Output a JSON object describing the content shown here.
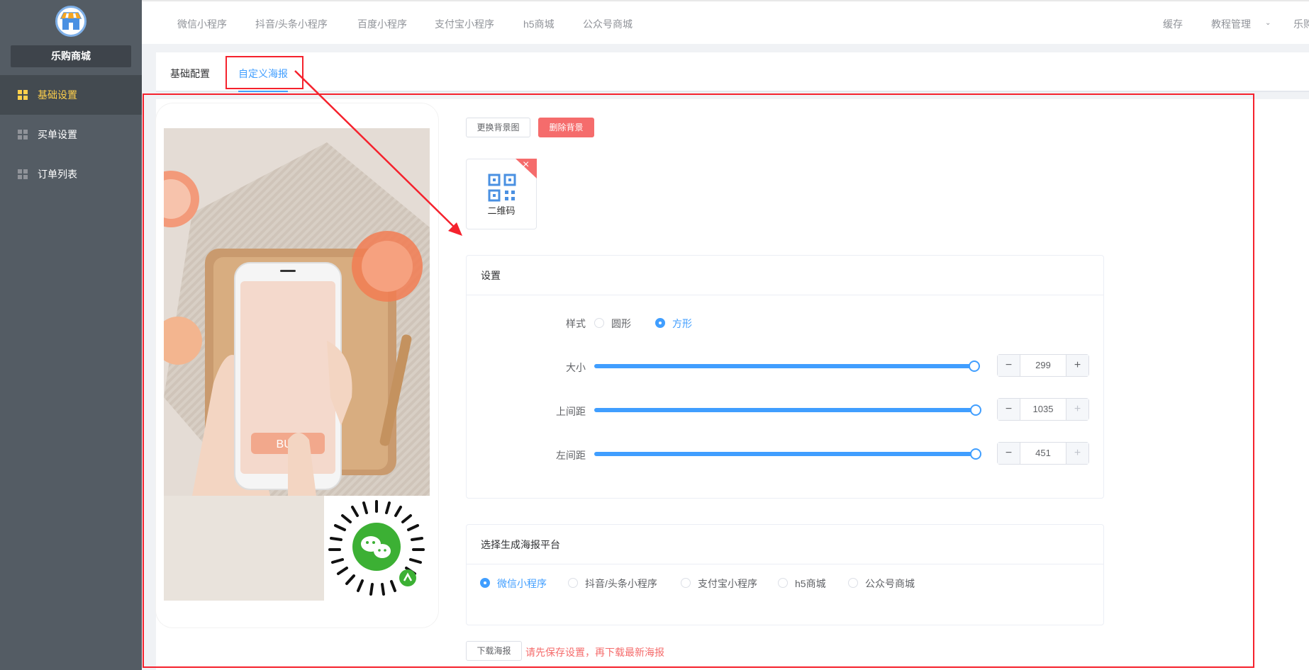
{
  "sidebar": {
    "shop_name": "乐购商城",
    "items": [
      {
        "label": "基础设置",
        "active": true
      },
      {
        "label": "买单设置",
        "active": false
      },
      {
        "label": "订单列表",
        "active": false
      }
    ]
  },
  "topbar": {
    "tabs": [
      "微信小程序",
      "抖音/头条小程序",
      "百度小程序",
      "支付宝小程序",
      "h5商城",
      "公众号商城"
    ],
    "right": [
      "缓存",
      "教程管理",
      "乐购"
    ]
  },
  "subtabs": [
    {
      "label": "基础配置",
      "active": false
    },
    {
      "label": "自定义海报",
      "active": true
    }
  ],
  "poster": {
    "buy_text": "BUY"
  },
  "actions": {
    "change_bg": "更换背景图",
    "delete_bg": "删除背景"
  },
  "qr_item": {
    "label": "二维码"
  },
  "settings": {
    "title": "设置",
    "style_label": "样式",
    "style_options": [
      {
        "label": "圆形",
        "selected": false
      },
      {
        "label": "方形",
        "selected": true
      }
    ],
    "sliders": [
      {
        "label": "大小",
        "value": "299",
        "fill": 1.0
      },
      {
        "label": "上间距",
        "value": "1035",
        "fill": 1.0
      },
      {
        "label": "左间距",
        "value": "451",
        "fill": 1.0
      }
    ]
  },
  "platform": {
    "title": "选择生成海报平台",
    "options": [
      {
        "label": "微信小程序",
        "selected": true
      },
      {
        "label": "抖音/头条小程序",
        "selected": false
      },
      {
        "label": "支付宝小程序",
        "selected": false
      },
      {
        "label": "h5商城",
        "selected": false
      },
      {
        "label": "公众号商城",
        "selected": false
      }
    ]
  },
  "download": {
    "button": "下载海报",
    "hint": "请先保存设置，再下载最新海报"
  }
}
